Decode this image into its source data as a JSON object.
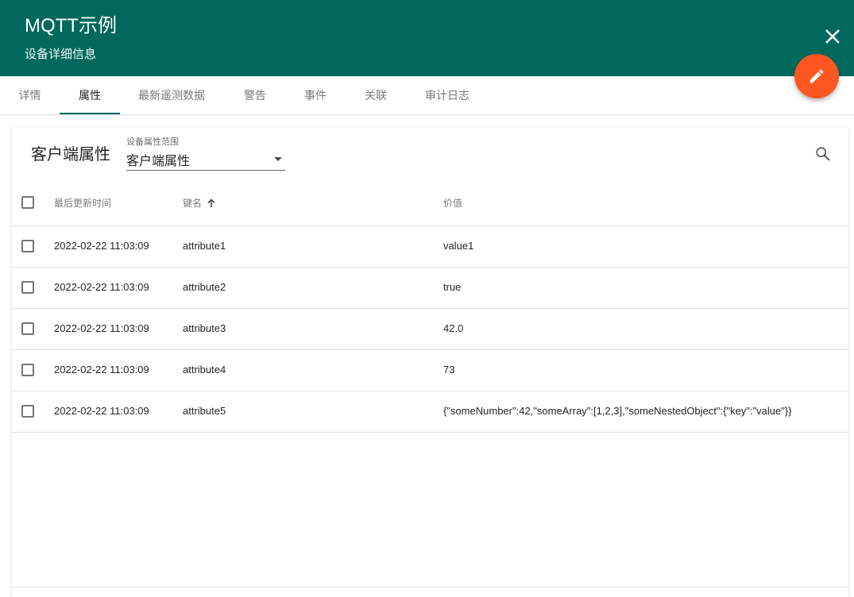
{
  "header": {
    "title": "MQTT示例",
    "subtitle": "设备详细信息",
    "background_color": "#00695c",
    "close_icon": "close-icon"
  },
  "fab": {
    "icon": "edit-icon",
    "color": "#ff5722"
  },
  "tabs": [
    {
      "label": "详情",
      "active": false
    },
    {
      "label": "属性",
      "active": true
    },
    {
      "label": "最新遥测数据",
      "active": false
    },
    {
      "label": "警告",
      "active": false
    },
    {
      "label": "事件",
      "active": false
    },
    {
      "label": "关联",
      "active": false
    },
    {
      "label": "审计日志",
      "active": false
    }
  ],
  "attributes": {
    "title": "客户端属性",
    "scope_label": "设备属性范围",
    "scope_value": "客户端属性",
    "search_icon": "search-icon",
    "columns": {
      "last_update": "最后更新时间",
      "key": "键名",
      "value": "价值"
    },
    "sort_icon": "arrow-upward-icon",
    "rows": [
      {
        "time": "2022-02-22 11:03:09",
        "key": "attribute1",
        "value": "value1"
      },
      {
        "time": "2022-02-22 11:03:09",
        "key": "attribute2",
        "value": "true"
      },
      {
        "time": "2022-02-22 11:03:09",
        "key": "attribute3",
        "value": "42.0"
      },
      {
        "time": "2022-02-22 11:03:09",
        "key": "attribute4",
        "value": "73"
      },
      {
        "time": "2022-02-22 11:03:09",
        "key": "attribute5",
        "value": "{\"someNumber\":42,\"someArray\":[1,2,3],\"someNestedObject\":{\"key\":\"value\"}}"
      }
    ]
  }
}
